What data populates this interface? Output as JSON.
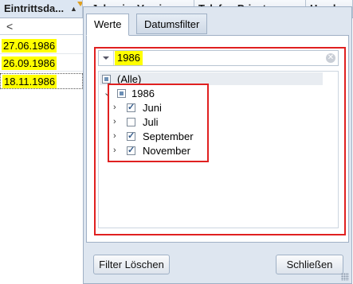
{
  "grid": {
    "columns": [
      {
        "label": "Eintrittsda..."
      },
      {
        "label": "Jahre im Verein"
      },
      {
        "label": "Telefon Privat"
      },
      {
        "label": "Handy"
      }
    ],
    "filter_row_value": "<",
    "rows": [
      "27.06.1986",
      "26.09.1986",
      "18.11.1986"
    ]
  },
  "popup": {
    "tabs": [
      {
        "label": "Werte",
        "active": true
      },
      {
        "label": "Datumsfilter",
        "active": false
      }
    ],
    "search": {
      "value": "1986",
      "clear_glyph": "✕"
    },
    "tree": {
      "all": {
        "label": "(Alle)",
        "state": "partial"
      },
      "year": {
        "label": "1986",
        "state": "partial",
        "expanded": true
      },
      "months": [
        {
          "label": "Juni",
          "checked": true
        },
        {
          "label": "Juli",
          "checked": false
        },
        {
          "label": "September",
          "checked": true
        },
        {
          "label": "November",
          "checked": true
        }
      ]
    },
    "buttons": {
      "clear": "Filter Löschen",
      "close": "Schließen"
    }
  },
  "colors": {
    "highlight": "#ffff00",
    "annotation": "#e02020"
  }
}
